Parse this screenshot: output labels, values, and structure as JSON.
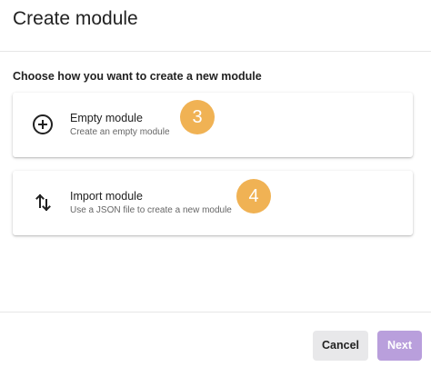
{
  "header": {
    "title": "Create module"
  },
  "main": {
    "subtitle": "Choose how you want to create a new module",
    "options": [
      {
        "label": "Empty module",
        "description": "Create an empty module",
        "icon": "add-circle-icon",
        "badge": "3"
      },
      {
        "label": "Import module",
        "description": "Use a JSON file to create a new module",
        "icon": "swap-vertical-icon",
        "badge": "4"
      }
    ]
  },
  "footer": {
    "cancel_label": "Cancel",
    "next_label": "Next"
  },
  "colors": {
    "badge": "#f0b254",
    "next_button": "#b99fdc",
    "cancel_button": "#e8e8ea"
  }
}
